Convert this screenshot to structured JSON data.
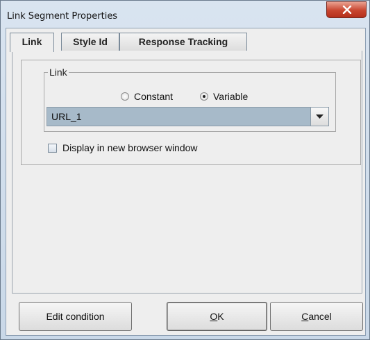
{
  "window": {
    "title": "Link Segment Properties"
  },
  "tabs": [
    {
      "label": "Link",
      "active": true
    },
    {
      "label": "Style Id",
      "active": false
    },
    {
      "label": "Response Tracking",
      "active": false
    }
  ],
  "link_group": {
    "legend": "Link",
    "radio_constant": "Constant",
    "radio_variable": "Variable",
    "selected": "Variable",
    "combo_value": "URL_1"
  },
  "new_window_checkbox": {
    "label": "Display in new browser window",
    "checked": false
  },
  "buttons": {
    "edit_condition": "Edit condition",
    "ok_mnemonic": "O",
    "ok_rest": "K",
    "cancel_mnemonic": "C",
    "cancel_rest": "ancel"
  },
  "icons": {
    "close": "close-icon",
    "dropdown": "chevron-down-icon"
  },
  "colors": {
    "close_button": "#c8452f",
    "combo_background": "#a7bac9",
    "title_bar": "#c9d8e8"
  }
}
